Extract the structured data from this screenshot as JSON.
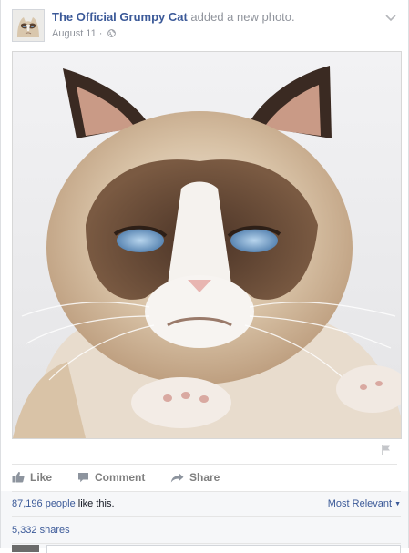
{
  "post": {
    "page_name": "The Official Grumpy Cat",
    "action_text": " added a new photo.",
    "date": "August 11",
    "separator": " · "
  },
  "actions": {
    "like": "Like",
    "comment": "Comment",
    "share": "Share"
  },
  "stats": {
    "likes_count": "87,196 people",
    "likes_suffix": " like this.",
    "sort_label": "Most Relevant",
    "shares": "5,332 shares"
  },
  "icons": {
    "audience": "globe-icon",
    "options": "chevron-down-icon",
    "report": "flag-icon",
    "like": "thumbs-up-icon",
    "comment": "speech-bubble-icon",
    "share": "share-arrow-icon"
  },
  "colors": {
    "link": "#3b5998",
    "muted": "#90949c",
    "action": "#7f7f7f"
  }
}
